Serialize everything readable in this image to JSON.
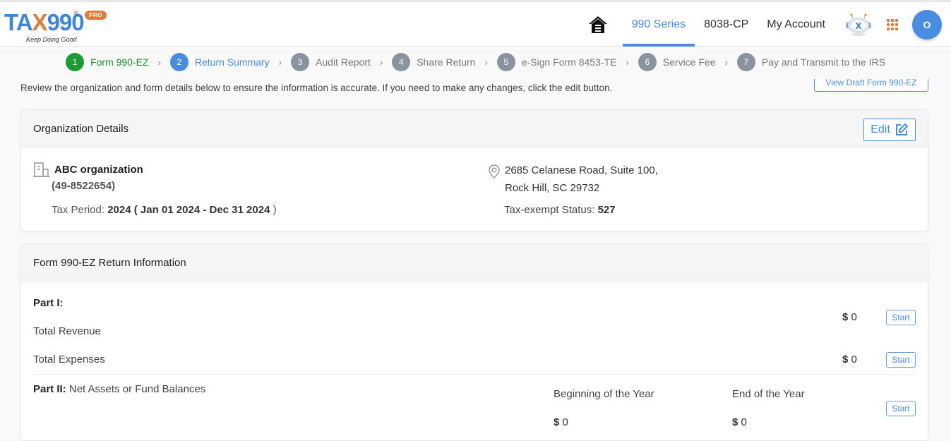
{
  "brand": {
    "name_part1": "TA",
    "name_x": "X",
    "name_part2": "990",
    "registered": "®",
    "badge": "PRO",
    "tagline": "Keep Doing Good"
  },
  "nav": {
    "home_icon": "home-icon",
    "links": [
      {
        "label": "990 Series",
        "active": true
      },
      {
        "label": "8038-CP",
        "active": false
      },
      {
        "label": "My Account",
        "active": false
      }
    ],
    "bot_icon": "assistant-bot-icon",
    "apps_icon": "apps-grid-icon",
    "avatar_initial": "O"
  },
  "stepper": {
    "steps": [
      {
        "num": "1",
        "label": "Form 990-EZ",
        "state": "done"
      },
      {
        "num": "2",
        "label": "Return Summary",
        "state": "current"
      },
      {
        "num": "3",
        "label": "Audit Report",
        "state": "pending"
      },
      {
        "num": "4",
        "label": "Share Return",
        "state": "pending"
      },
      {
        "num": "5",
        "label": "e-Sign Form 8453-TE",
        "state": "pending"
      },
      {
        "num": "6",
        "label": "Service Fee",
        "state": "pending"
      },
      {
        "num": "7",
        "label": "Pay and Transmit to the IRS",
        "state": "pending"
      }
    ],
    "separator": "›"
  },
  "intro": "Review the organization and form details below to ensure the information is accurate. If you need to make any changes, click the edit button.",
  "view_draft_label": "View Draft Form 990-EZ",
  "organization": {
    "title": "Organization Details",
    "edit_label": "Edit",
    "name": "ABC organization",
    "ein": "(49-8522654)",
    "tax_period_label": "Tax Period:",
    "tax_period_year": "2024",
    "tax_period_range": "( Jan 01 2024 - Dec 31 2024",
    "tax_period_close": ")",
    "address_line1": "2685 Celanese Road, Suite 100,",
    "address_line2": "Rock Hill, SC 29732",
    "status_label": "Tax-exempt Status:",
    "status_value": "527"
  },
  "return_info": {
    "title": "Form 990-EZ Return Information",
    "part1_label": "Part I:",
    "rows": [
      {
        "label": "Total Revenue",
        "currency": "$",
        "amount": "0",
        "button": "Start"
      },
      {
        "label": "Total Expenses",
        "currency": "$",
        "amount": "0",
        "button": "Start"
      }
    ],
    "part2": {
      "label": "Part II:",
      "title": "Net Assets or Fund Balances",
      "beginning_label": "Beginning of the Year",
      "end_label": "End of the Year",
      "currency": "$",
      "beginning_amount": "0",
      "end_amount": "0",
      "button": "Start"
    }
  },
  "colors": {
    "primary": "#4a8de0",
    "brand_orange": "#e07b39",
    "done_green": "#1e9a32",
    "pending_gray": "#8a93a0"
  }
}
